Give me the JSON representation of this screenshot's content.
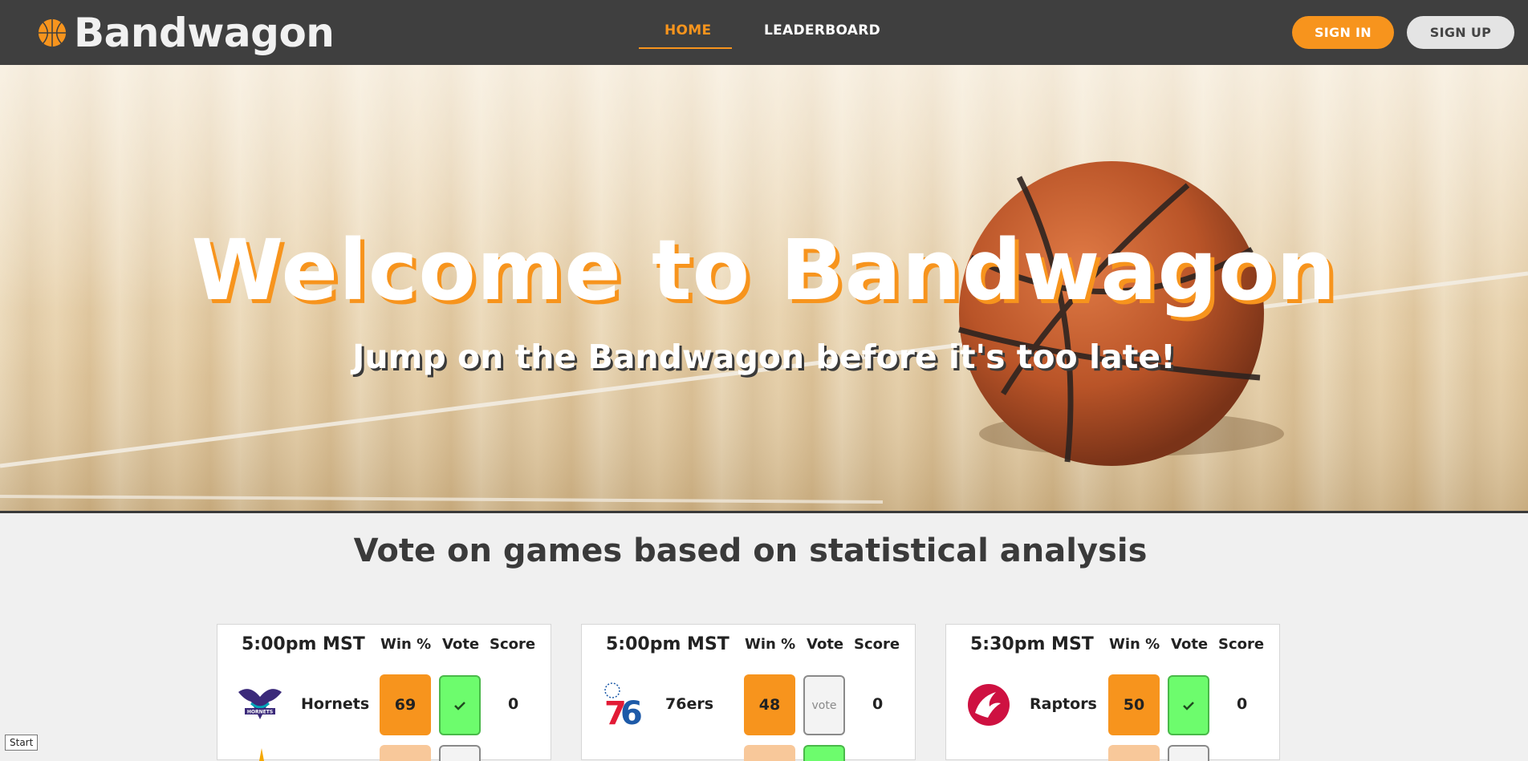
{
  "header": {
    "brand": "Bandwagon",
    "nav": {
      "home": "HOME",
      "leaderboard": "LEADERBOARD"
    },
    "sign_in": "SIGN IN",
    "sign_up": "SIGN UP"
  },
  "hero": {
    "title": "Welcome to Bandwagon",
    "subtitle": "Jump on the Bandwagon before it's too late!"
  },
  "section": {
    "title": "Vote on games based on statistical analysis"
  },
  "columns": {
    "win": "Win %",
    "vote": "Vote",
    "score": "Score"
  },
  "games": [
    {
      "time": "5:00pm MST",
      "team": "Hornets",
      "win_pct": "69",
      "vote_label": "",
      "voted": true,
      "score": "0"
    },
    {
      "time": "5:00pm MST",
      "team": "76ers",
      "win_pct": "48",
      "vote_label": "vote",
      "voted": false,
      "score": "0"
    },
    {
      "time": "5:30pm MST",
      "team": "Raptors",
      "win_pct": "50",
      "vote_label": "",
      "voted": true,
      "score": "0"
    }
  ],
  "taskbar": {
    "start": "Start"
  },
  "colors": {
    "accent": "#f7941d",
    "navbar": "#3f3f3f",
    "vote_yes": "#6dfc6d"
  },
  "icons": {
    "brand": "basketball-icon",
    "check": "checkmark-icon"
  }
}
